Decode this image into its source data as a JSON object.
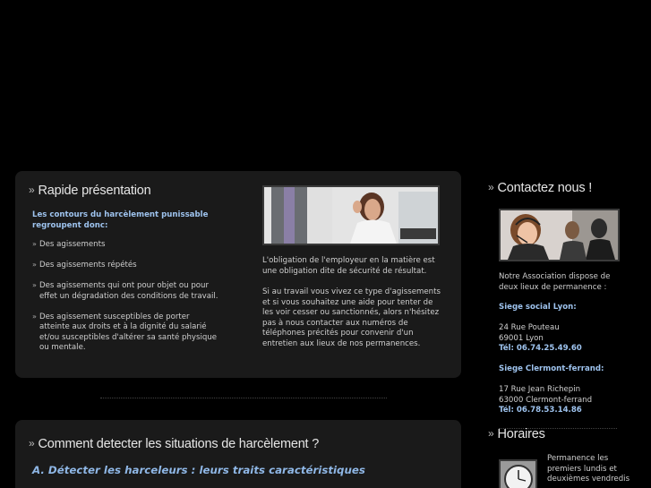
{
  "presentation": {
    "heading": "Rapide présentation",
    "intro": "Les contours du harcèlement punissable regroupent donc:",
    "bullets": [
      "Des agissements",
      "Des agissements répétés",
      "Des agissements qui ont pour objet ou pour effet un dégradation des conditions de travail.",
      "Des agissement susceptibles de porter atteinte aux droits et à la dignité du salarié et/ou susceptibles d'altérer sa santé physique ou mentale."
    ],
    "para1": "L'obligation de l'employeur en la matière est une obligation dite de sécurité de résultat.",
    "para2": "Si au travail vous vivez ce type d'agissements et si vous souhaitez une aide pour tenter de les voir cesser ou sanctionnés, alors n'hésitez pas à nous contacter aux numéros de téléphones précités pour convenir d'un entretien aux lieux de nos permanences."
  },
  "detect": {
    "heading": "Comment detecter les situations de harcèlement ?",
    "subtitle": "A. Détecter les harceleurs : leurs traits caractéristiques"
  },
  "contact": {
    "heading": "Contactez nous !",
    "intro": "Notre Association dispose de deux lieux de permanence :",
    "lyon_title": "Siege social Lyon:",
    "lyon_street": "24 Rue Pouteau",
    "lyon_city": "69001 Lyon",
    "lyon_tel": "Tél: 06.74.25.49.60",
    "cf_title": "Siege Clermont-ferrand:",
    "cf_street": "17 Rue Jean Richepin",
    "cf_city": "63000 Clermont-ferrand",
    "cf_tel": "Tél: 06.78.53.14.86"
  },
  "horaires": {
    "heading": "Horaires",
    "text": "Permanence les premiers lundis et deuxièmes vendredis"
  },
  "bullet_glyph": "»"
}
